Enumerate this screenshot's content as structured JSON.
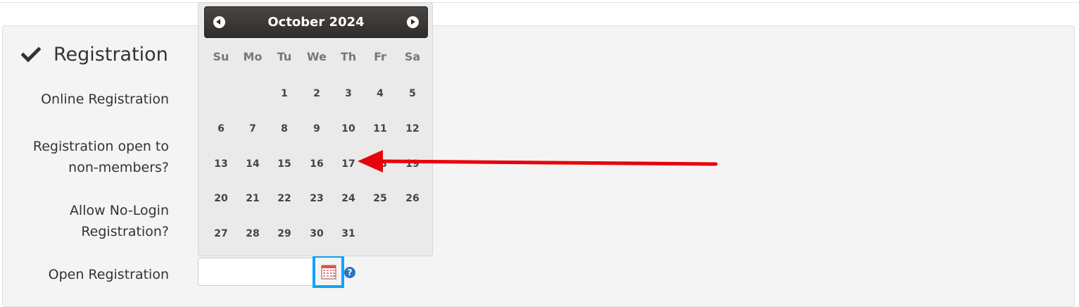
{
  "section": {
    "title": "Registration",
    "icon": "check-icon"
  },
  "fields": {
    "online_registration": "Online Registration",
    "open_to_nonmembers_line1": "Registration open to",
    "open_to_nonmembers_line2": "non-members?",
    "allow_nologin_line1": "Allow No-Login",
    "allow_nologin_line2": "Registration?",
    "open_registration": "Open Registration",
    "open_registration_value": "",
    "help_glyph": "?"
  },
  "datepicker": {
    "month_year": "October 2024",
    "weekdays": [
      "Su",
      "Mo",
      "Tu",
      "We",
      "Th",
      "Fr",
      "Sa"
    ],
    "leading_blanks": 2,
    "days_in_month": 31,
    "annotation_target_day": 17
  },
  "colors": {
    "arrow": "#e8000b",
    "highlight": "#0ea5f5",
    "help": "#2d72c4"
  }
}
